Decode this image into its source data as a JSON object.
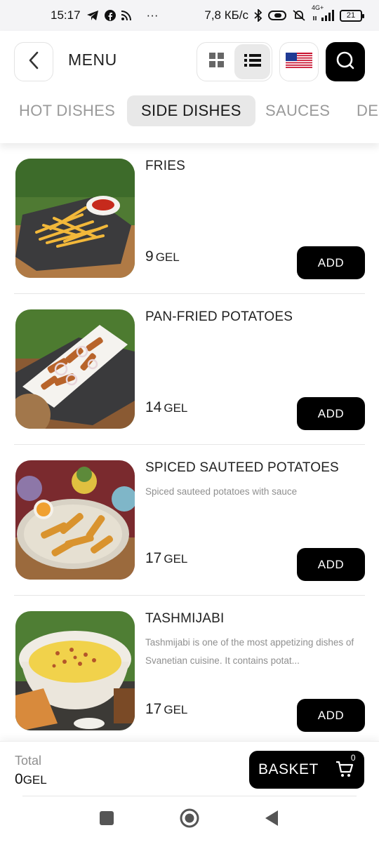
{
  "status_bar": {
    "time": "15:17",
    "left_icons": [
      "telegram-icon",
      "facebook-icon",
      "rss-icon"
    ],
    "more": "···",
    "speed": "7,8 КБ/с",
    "signal_label": "4G+",
    "battery": "21"
  },
  "header": {
    "title": "MENU",
    "language": "en-US"
  },
  "tabs": [
    {
      "label": "HOT DISHES",
      "active": false
    },
    {
      "label": "SIDE DISHES",
      "active": true
    },
    {
      "label": "SAUCES",
      "active": false
    },
    {
      "label": "DE",
      "active": false
    }
  ],
  "items": [
    {
      "title": "FRIES",
      "description": "",
      "price": "9",
      "currency": "GEL",
      "add_label": "ADD"
    },
    {
      "title": "PAN-FRIED POTATOES",
      "description": "",
      "price": "14",
      "currency": "GEL",
      "add_label": "ADD"
    },
    {
      "title": "SPICED SAUTEED POTATOES",
      "description": "Spiced sauteed potatoes with sauce",
      "price": "17",
      "currency": "GEL",
      "add_label": "ADD"
    },
    {
      "title": "TASHMIJABI",
      "description": "Tashmijabi is one of the most appetizing dishes of Svanetian cuisine. It contains potat...",
      "price": "17",
      "currency": "GEL",
      "add_label": "ADD"
    }
  ],
  "footer": {
    "total_label": "Total",
    "total_value": "0",
    "total_currency": "GEL",
    "basket_label": "BASKET",
    "basket_count": "0"
  },
  "colors": {
    "accent": "#000000",
    "inactive_tab": "#9a9a9a",
    "active_tab_bg": "#e8e8e8",
    "description": "#8f8f8f"
  }
}
